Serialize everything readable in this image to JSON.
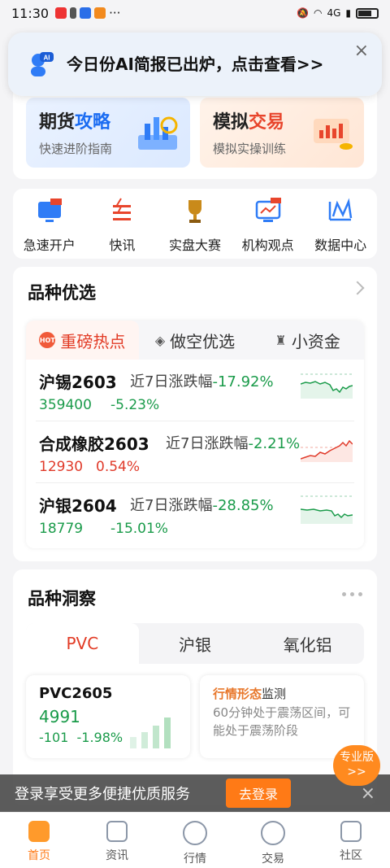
{
  "status": {
    "time": "11:30",
    "network": "4G"
  },
  "toast": {
    "text": "今日份AI简报已出炉，点击查看>>",
    "close": "×",
    "icon_label": "AI"
  },
  "promos": [
    {
      "title_a": "期货",
      "title_b": "攻略",
      "sub": "快速进阶指南"
    },
    {
      "title_a": "模拟",
      "title_b": "交易",
      "sub": "模拟实操训练"
    }
  ],
  "quick": [
    {
      "label": "急速开户",
      "icon": "open-account-icon"
    },
    {
      "label": "快讯",
      "icon": "news-flash-icon"
    },
    {
      "label": "实盘大赛",
      "icon": "trophy-icon"
    },
    {
      "label": "机构观点",
      "icon": "institution-view-icon"
    },
    {
      "label": "数据中心",
      "icon": "data-center-icon"
    }
  ],
  "selection": {
    "title": "品种优选",
    "tabs": [
      "重磅热点",
      "做空优选",
      "小资金"
    ],
    "hot_badge": "HOT",
    "rows": [
      {
        "name": "沪锡2603",
        "label": "近7日涨跌幅",
        "pct": "-17.92%",
        "price": "359400",
        "chg": "-5.23%",
        "trend": "down"
      },
      {
        "name": "合成橡胶2603",
        "label": "近7日涨跌幅",
        "pct": "-2.21%",
        "price": "12930",
        "chg": "0.54%",
        "trend": "up"
      },
      {
        "name": "沪银2604",
        "label": "近7日涨跌幅",
        "pct": "-28.85%",
        "price": "18779",
        "chg": "-15.01%",
        "trend": "down"
      }
    ]
  },
  "insight": {
    "title": "品种洞察",
    "tabs": [
      "PVC",
      "沪银",
      "氧化铝"
    ],
    "quote": {
      "code": "PVC2605",
      "price": "4991",
      "chg": "-101",
      "pct": "-1.98%"
    },
    "monitor": {
      "title_a": "行情形态",
      "title_b": "监测",
      "desc": "60分钟处于震荡区间，可能处于震荡阶段"
    }
  },
  "pro_badge": {
    "line1": "专业版",
    "line2": ">>"
  },
  "login_bar": {
    "message": "登录享受更多便捷优质服务",
    "button": "去登录",
    "close": "×"
  },
  "nav": [
    "首页",
    "资讯",
    "行情",
    "交易",
    "社区"
  ],
  "colors": {
    "accent": "#ff7a16",
    "red": "#e03a2a",
    "green": "#1a9b4a",
    "blue": "#1b6cf2"
  }
}
